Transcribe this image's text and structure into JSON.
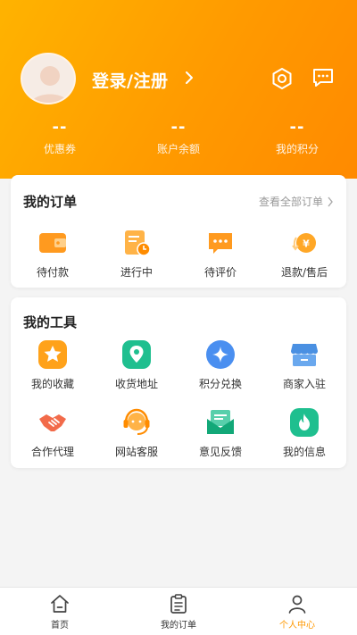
{
  "header": {
    "login_label": "登录/注册",
    "stats": [
      {
        "value": "--",
        "label": "优惠券"
      },
      {
        "value": "--",
        "label": "账户余额"
      },
      {
        "value": "--",
        "label": "我的积分"
      }
    ]
  },
  "orders": {
    "title": "我的订单",
    "view_all": "查看全部订单",
    "items": [
      {
        "label": "待付款",
        "icon": "wallet-icon"
      },
      {
        "label": "进行中",
        "icon": "in-progress-icon"
      },
      {
        "label": "待评价",
        "icon": "comment-icon"
      },
      {
        "label": "退款/售后",
        "icon": "refund-icon"
      }
    ]
  },
  "tools": {
    "title": "我的工具",
    "items": [
      {
        "label": "我的收藏",
        "icon": "star-icon"
      },
      {
        "label": "收货地址",
        "icon": "location-icon"
      },
      {
        "label": "积分兑换",
        "icon": "points-icon"
      },
      {
        "label": "商家入驻",
        "icon": "store-icon"
      },
      {
        "label": "合作代理",
        "icon": "handshake-icon"
      },
      {
        "label": "网站客服",
        "icon": "headset-icon"
      },
      {
        "label": "意见反馈",
        "icon": "feedback-mail-icon"
      },
      {
        "label": "我的信息",
        "icon": "fire-icon"
      }
    ]
  },
  "bottom_nav": [
    {
      "label": "首页",
      "icon": "home-icon",
      "active": false
    },
    {
      "label": "我的订单",
      "icon": "clipboard-icon",
      "active": false
    },
    {
      "label": "个人中心",
      "icon": "user-icon",
      "active": true
    }
  ],
  "colors": {
    "header_start": "#ffb300",
    "header_end": "#ff8a00",
    "accent": "#ff9800",
    "page_bg": "#f4f4f4"
  }
}
